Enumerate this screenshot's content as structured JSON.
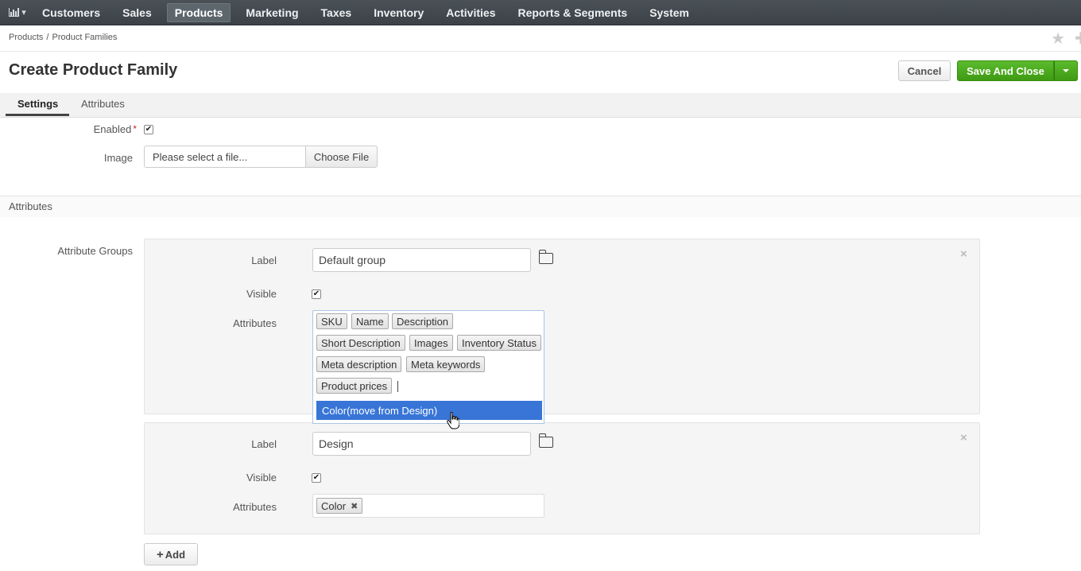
{
  "nav": {
    "items": [
      {
        "label": "Customers",
        "active": false
      },
      {
        "label": "Sales",
        "active": false
      },
      {
        "label": "Products",
        "active": true
      },
      {
        "label": "Marketing",
        "active": false
      },
      {
        "label": "Taxes",
        "active": false
      },
      {
        "label": "Inventory",
        "active": false
      },
      {
        "label": "Activities",
        "active": false
      },
      {
        "label": "Reports & Segments",
        "active": false
      },
      {
        "label": "System",
        "active": false
      }
    ]
  },
  "breadcrumb": {
    "parent": "Products",
    "separator": "/",
    "current": "Product Families"
  },
  "page": {
    "title": "Create Product Family",
    "cancel_label": "Cancel",
    "save_label": "Save And Close"
  },
  "tabs": [
    {
      "label": "Settings",
      "active": true
    },
    {
      "label": "Attributes",
      "active": false
    }
  ],
  "settings": {
    "enabled_label": "Enabled",
    "required_mark": "*",
    "enabled_checked": true,
    "image_label": "Image",
    "image_placeholder": "Please select a file...",
    "choose_file_label": "Choose File"
  },
  "attributes_section": {
    "title": "Attributes",
    "groups_label": "Attribute Groups",
    "label_label": "Label",
    "visible_label": "Visible",
    "attributes_label": "Attributes",
    "groups": [
      {
        "label_value": "Default group",
        "visible": true,
        "tags": [
          "SKU",
          "Name",
          "Description",
          "Short Description",
          "Images",
          "Inventory Status",
          "Meta description",
          "Meta keywords",
          "Product prices"
        ]
      },
      {
        "label_value": "Design",
        "visible": true,
        "tags": [
          "Color"
        ]
      }
    ],
    "dropdown_option": "Color(move from Design)",
    "add_label": "Add"
  },
  "colors": {
    "save_green": "#4aab1e",
    "highlight_blue": "#3875d7",
    "nav_bg": "#40474c"
  }
}
